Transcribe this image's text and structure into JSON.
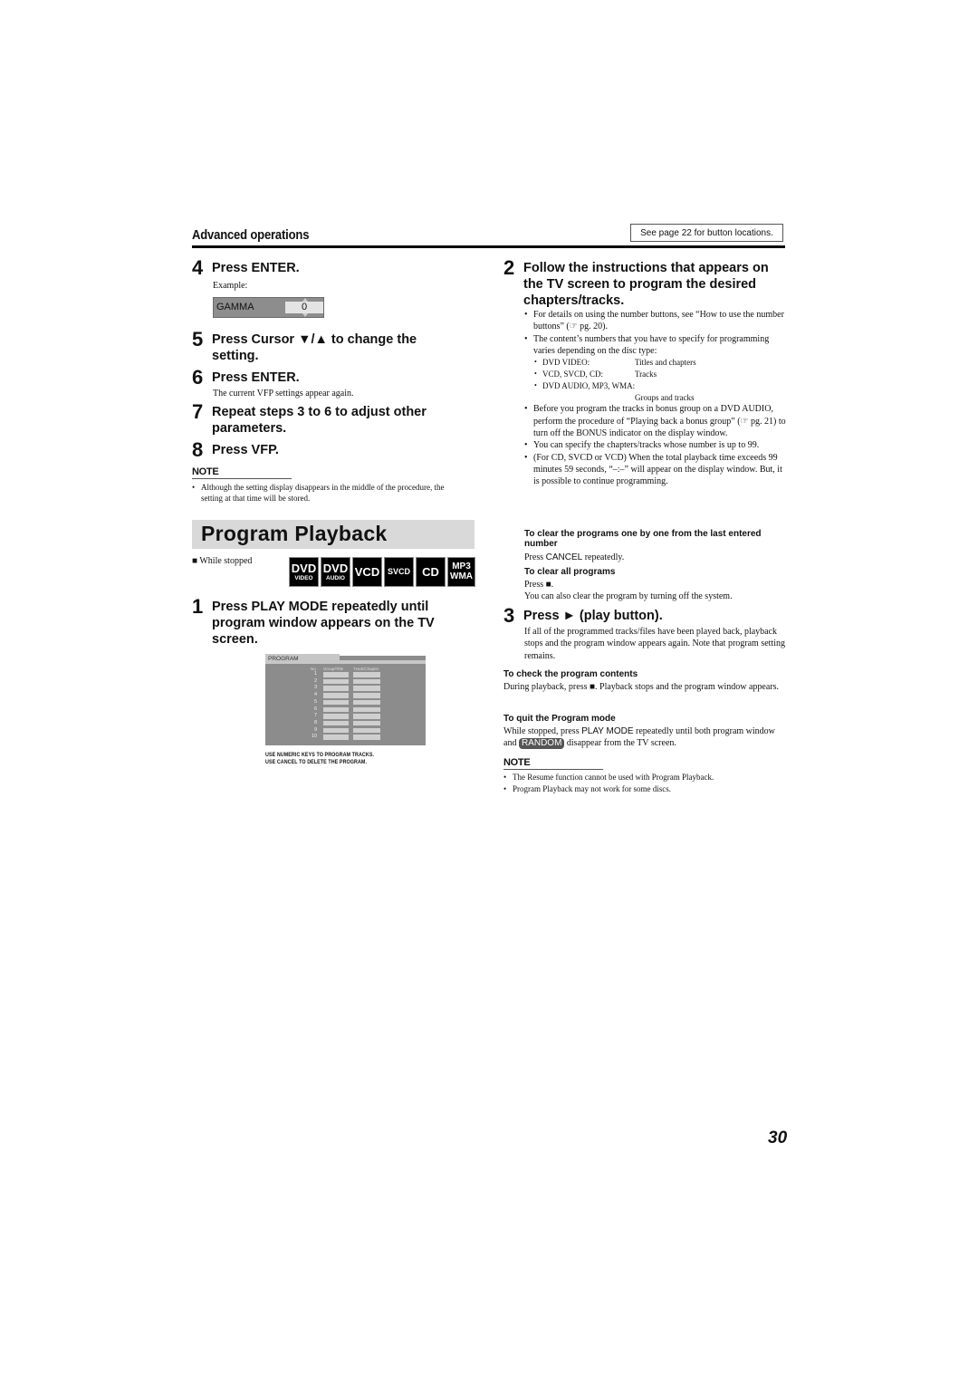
{
  "header": {
    "section_label": "Advanced operations",
    "see_page": "See page 22 for button locations."
  },
  "left": {
    "step4": {
      "num": "4",
      "title": "Press ENTER.",
      "example_label": "Example:"
    },
    "gamma_display": {
      "label": "GAMMA",
      "value": "0"
    },
    "step5": {
      "num": "5",
      "title": "Press Cursor ▼/▲ to change the setting."
    },
    "step6": {
      "num": "6",
      "title": "Press ENTER.",
      "desc": "The current VFP settings appear again."
    },
    "step7": {
      "num": "7",
      "title": "Repeat steps 3 to 6 to adjust other parameters."
    },
    "step8": {
      "num": "8",
      "title": "Press VFP."
    },
    "note": {
      "heading": "NOTE",
      "items": [
        "Although the setting display disappears in the middle of the procedure, the setting at that time will be stored."
      ]
    },
    "program_playback": {
      "title": "Program Playback",
      "condition": "■ While stopped",
      "discs": [
        {
          "big": "DVD",
          "small": "VIDEO"
        },
        {
          "big": "DVD",
          "small": "AUDIO"
        },
        {
          "big": "VCD",
          "small": ""
        },
        {
          "big": "SVCD",
          "small": ""
        },
        {
          "big": "CD",
          "small": ""
        },
        {
          "big": "MP3",
          "small": "WMA"
        }
      ],
      "step1": {
        "num": "1",
        "title": "Press PLAY MODE repeatedly until program window appears on the TV screen."
      },
      "tv_screen": {
        "tab": "PROGRAM",
        "col_no": "No.",
        "col_group": "Group/Title",
        "col_track": "Track/Chapter",
        "rows": [
          "1",
          "2",
          "3",
          "4",
          "5",
          "6",
          "7",
          "8",
          "9",
          "10"
        ],
        "msg1": "USE NUMERIC KEYS TO PROGRAM TRACKS.",
        "msg2": "USE CANCEL TO DELETE THE PROGRAM."
      }
    }
  },
  "right": {
    "step2": {
      "num": "2",
      "title": "Follow the instructions that appears on the TV screen to program the desired chapters/tracks.",
      "bullets": [
        "For details on using the number buttons, see “How to use the number buttons” (☞ pg. 20).",
        "The content’s numbers that you have to specify for programming varies depending on the disc type:"
      ],
      "disc_types": [
        {
          "type": "DVD VIDEO:",
          "content": "Titles and chapters"
        },
        {
          "type": "VCD, SVCD, CD:",
          "content": "Tracks"
        },
        {
          "type": "DVD AUDIO, MP3, WMA:",
          "content": "Groups and tracks"
        }
      ],
      "bullets2": [
        "Before you program the tracks in bonus group on a DVD AUDIO, perform the procedure of “Playing back a bonus group” (☞ pg. 21) to turn off the BONUS indicator on the display window.",
        "You can specify the chapters/tracks whose number is up to 99.",
        "(For CD, SVCD or VCD) When the total playback time exceeds 99 minutes 59 seconds, “–:–” will appear on the display window. But, it is possible to continue programming."
      ]
    },
    "clear_one": {
      "heading": "To clear the programs one by one from the last entered number",
      "text_pre": "Press ",
      "button": "CANCEL",
      "text_post": " repeatedly."
    },
    "clear_all": {
      "heading": "To clear all programs",
      "line1": "Press ■.",
      "line2": "You can also clear the program by turning off the system."
    },
    "step3": {
      "num": "3",
      "title": "Press ► (play button).",
      "desc": "If all of the programmed tracks/files have been played back, playback stops and the program window appears again. Note that program setting remains."
    },
    "check": {
      "heading": "To check the program contents",
      "text": "During playback, press ■. Playback stops and the program window appears."
    },
    "quit": {
      "heading": "To quit the Program mode",
      "text_pre": "While stopped, press ",
      "button": "PLAY MODE",
      "text_mid": " repeatedly until both program window and ",
      "chip": "RANDOM",
      "text_post": " disappear from the TV screen."
    },
    "note": {
      "heading": "NOTE",
      "items": [
        "The Resume function cannot be used with Program Playback.",
        "Program Playback may not work for some discs."
      ]
    }
  },
  "page_number": "30"
}
